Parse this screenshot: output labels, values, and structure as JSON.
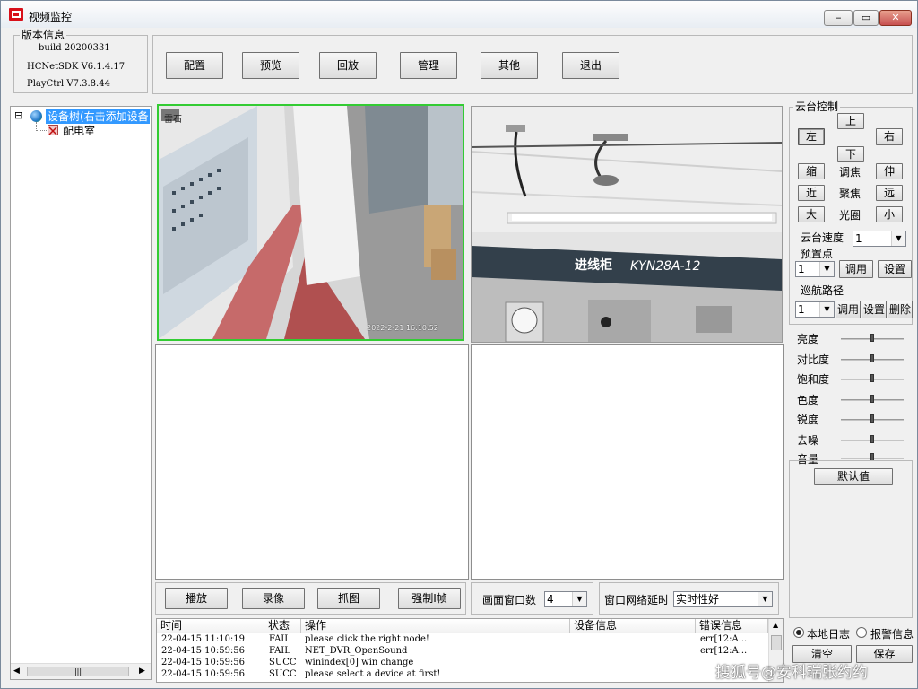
{
  "window": {
    "title": "视频监控",
    "minimize": "‒",
    "maximize": "▭",
    "close": "✕"
  },
  "version": {
    "group_label": "版本信息",
    "build": "build 20200331",
    "sdk": "HCNetSDK V6.1.4.17",
    "playctrl": "PlayCtrl V7.3.8.44"
  },
  "toolbar": {
    "config": "配置",
    "preview": "预览",
    "playback": "回放",
    "manage": "管理",
    "other": "其他",
    "exit": "退出"
  },
  "tree": {
    "root": "设备树(右击添加设备",
    "child": "配电室",
    "expander": "⊟"
  },
  "video": {
    "cam1_logo": "雷石",
    "cam1_timestamp": "2022-2-21 16:10:52",
    "cam2_text1": "进线柜",
    "cam2_text2": "KYN28A-12"
  },
  "ptz": {
    "group_label": "云台控制",
    "up": "上",
    "down": "下",
    "left": "左",
    "right": "右",
    "zoom_in": "缩",
    "zoom_label": "调焦",
    "zoom_out": "伸",
    "near": "近",
    "focus_label": "聚焦",
    "far": "远",
    "big": "大",
    "iris_label": "光圈",
    "small": "小",
    "speed_label": "云台速度",
    "speed_value": "1",
    "preset_label": "预置点",
    "preset_value": "1",
    "preset_call": "调用",
    "preset_set": "设置",
    "cruise_label": "巡航路径",
    "cruise_value": "1",
    "cruise_call": "调用",
    "cruise_set": "设置",
    "cruise_delete": "删除"
  },
  "image_adjust": {
    "items": [
      {
        "label": "亮度",
        "value": 0.5
      },
      {
        "label": "对比度",
        "value": 0.5
      },
      {
        "label": "饱和度",
        "value": 0.5
      },
      {
        "label": "色度",
        "value": 0.5
      },
      {
        "label": "锐度",
        "value": 0.5
      },
      {
        "label": "去噪",
        "value": 0.5
      },
      {
        "label": "音量",
        "value": 0.5
      }
    ],
    "default_button": "默认值"
  },
  "controls": {
    "play": "播放",
    "record": "录像",
    "capture": "抓图",
    "force_iframe": "强制I帧",
    "window_count_label": "画面窗口数",
    "window_count_value": "4",
    "net_delay_label": "窗口网络延时",
    "net_delay_value": "实时性好"
  },
  "log": {
    "headers": {
      "time": "时间",
      "status": "状态",
      "op": "操作",
      "device": "设备信息",
      "error": "错误信息"
    },
    "rows": [
      {
        "time": "22-04-15 11:10:19",
        "status": "FAIL",
        "op": "please click the right node!",
        "device": "",
        "error": "err[12:A..."
      },
      {
        "time": "22-04-15 10:59:56",
        "status": "FAIL",
        "op": "NET_DVR_OpenSound",
        "device": "",
        "error": "err[12:A..."
      },
      {
        "time": "22-04-15 10:59:56",
        "status": "SUCC",
        "op": "winindex[0] win change",
        "device": "",
        "error": ""
      },
      {
        "time": "22-04-15 10:59:56",
        "status": "SUCC",
        "op": "please select a device at first!",
        "device": "",
        "error": ""
      }
    ]
  },
  "log_options": {
    "local_log": "本地日志",
    "alarm_info": "报警信息",
    "clear": "清空",
    "save": "保存"
  },
  "watermark": "搜狐号@安科瑞张约约",
  "colors": {
    "selected_pane": "#33cc33",
    "tree_selected": "#3399ff"
  }
}
